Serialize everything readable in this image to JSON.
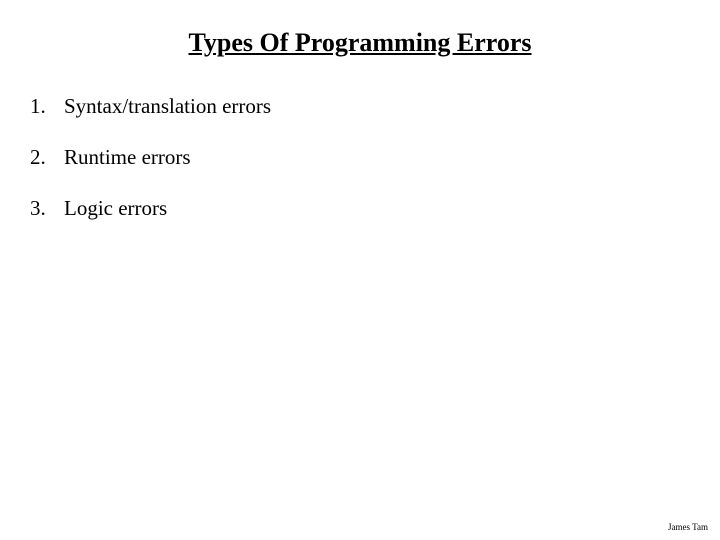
{
  "title": "Types Of Programming Errors",
  "items": [
    {
      "number": "1.",
      "text": "Syntax/translation errors"
    },
    {
      "number": "2.",
      "text": "Runtime errors"
    },
    {
      "number": "3.",
      "text": "Logic errors"
    }
  ],
  "footer": "James Tam"
}
